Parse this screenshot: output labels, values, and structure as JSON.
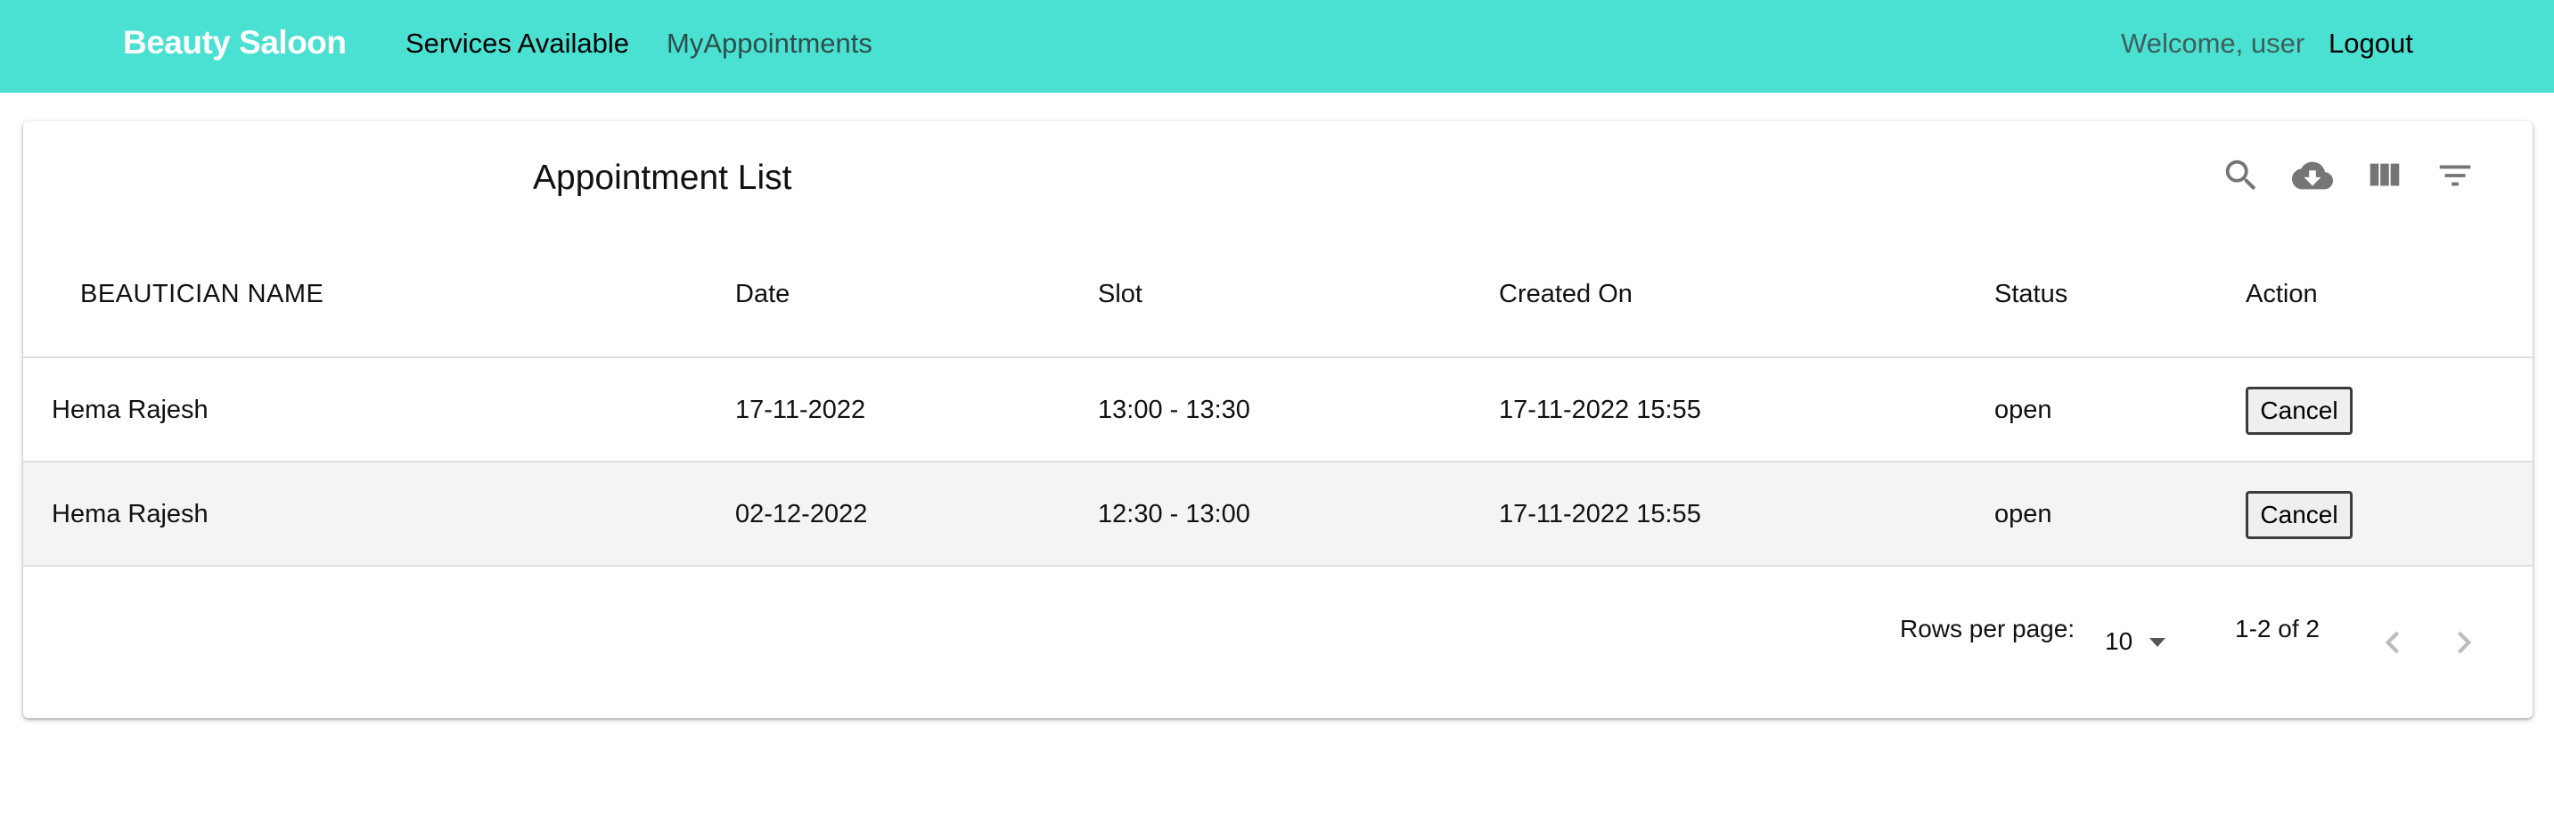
{
  "navbar": {
    "brand": "Beauty Saloon",
    "links": [
      {
        "label": "Services Available"
      },
      {
        "label": "MyAppointments"
      }
    ],
    "welcome": "Welcome, user",
    "logout": "Logout",
    "background_color": "#4ae1d2"
  },
  "table": {
    "title": "Appointment List",
    "toolbar_icons": [
      "search-icon",
      "cloud-download-icon",
      "view-columns-icon",
      "filter-icon"
    ],
    "columns": [
      "BEAUTICIAN NAME",
      "Date",
      "Slot",
      "Created On",
      "Status",
      "Action"
    ],
    "rows": [
      {
        "beautician": "Hema Rajesh",
        "date": "17-11-2022",
        "slot": "13:00 - 13:30",
        "created_on": "17-11-2022 15:55",
        "status": "open",
        "action": "Cancel"
      },
      {
        "beautician": "Hema Rajesh",
        "date": "02-12-2022",
        "slot": "12:30 - 13:00",
        "created_on": "17-11-2022 15:55",
        "status": "open",
        "action": "Cancel"
      }
    ]
  },
  "pagination": {
    "rows_per_page_label": "Rows per page:",
    "rows_per_page_value": "10",
    "range": "1-2 of 2",
    "prev_icon": "chevron-left-icon",
    "next_icon": "chevron-right-icon"
  }
}
